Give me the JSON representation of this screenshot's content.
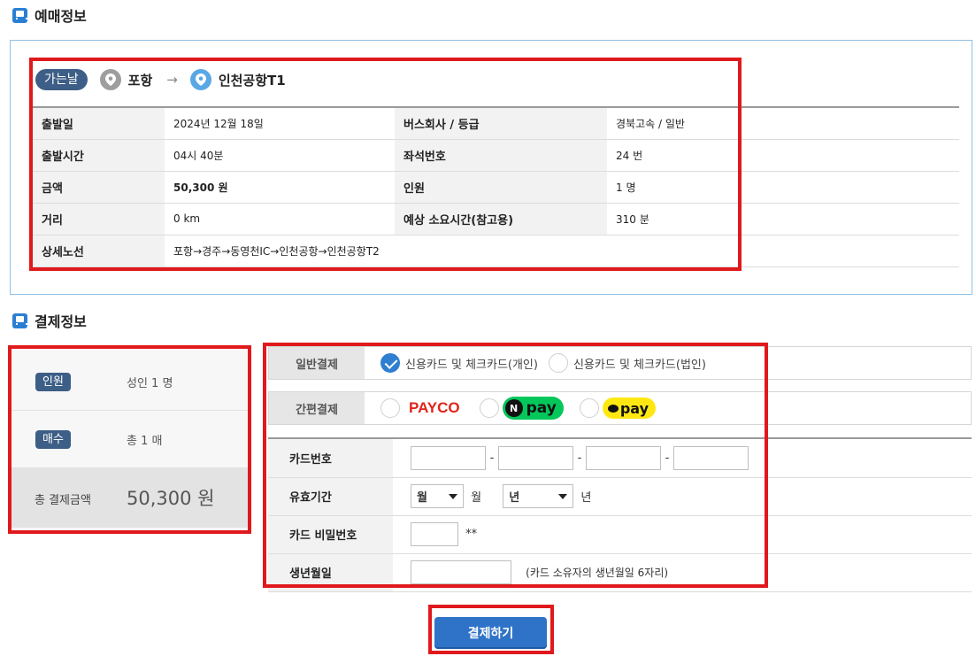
{
  "reservation": {
    "section_title": "예매정보",
    "direction_label": "가는날",
    "origin": "포항",
    "arrow": "→",
    "destination": "인천공항T1",
    "rows": [
      {
        "label1": "출발일",
        "value1": "2024년 12월 18일",
        "label2": "버스회사 / 등급",
        "value2": "경북고속 / 일반"
      },
      {
        "label1": "출발시간",
        "value1": "04시 40분",
        "label2": "좌석번호",
        "value2": "24 번"
      },
      {
        "label1": "금액",
        "value1": "50,300 원",
        "label2": "인원",
        "value2": "1 명"
      },
      {
        "label1": "거리",
        "value1": "0 km",
        "label2": "예상 소요시간(참고용)",
        "value2": "310 분"
      }
    ],
    "route_detail_label": "상세노선",
    "route_detail_value": "포항→경주→동영천IC→인천공항→인천공항T2"
  },
  "payment": {
    "section_title": "결제정보",
    "summary": {
      "people_tag": "인원",
      "people_value": "성인 1 명",
      "count_tag": "매수",
      "count_value": "총 1 매",
      "total_label": "총 결제금액",
      "total_value": "50,300 원"
    },
    "general": {
      "label": "일반결제",
      "option1": "신용카드 및 체크카드(개인)",
      "option2": "신용카드 및 체크카드(법인)"
    },
    "easy": {
      "label": "간편결제",
      "payco": "PAYCO",
      "npay_n": "N",
      "npay": "pay",
      "kakaopay": "pay"
    },
    "form": {
      "card_number_label": "카드번호",
      "card_sep": "-",
      "expiry_label": "유효기간",
      "month_select": "월",
      "month_unit": "월",
      "year_select": "년",
      "year_unit": "년",
      "pin_label": "카드 비밀번호",
      "pin_suffix": "**",
      "birth_label": "생년월일",
      "birth_hint": "(카드 소유자의 생년월일 6자리)"
    },
    "submit_label": "결제하기"
  },
  "colors": {
    "accent": "#2f73c8",
    "tag_bg": "#3d5e86",
    "highlight_border": "#e0191c",
    "payco": "#e2231a",
    "npay": "#03c75a",
    "kakaopay": "#ffe812"
  }
}
